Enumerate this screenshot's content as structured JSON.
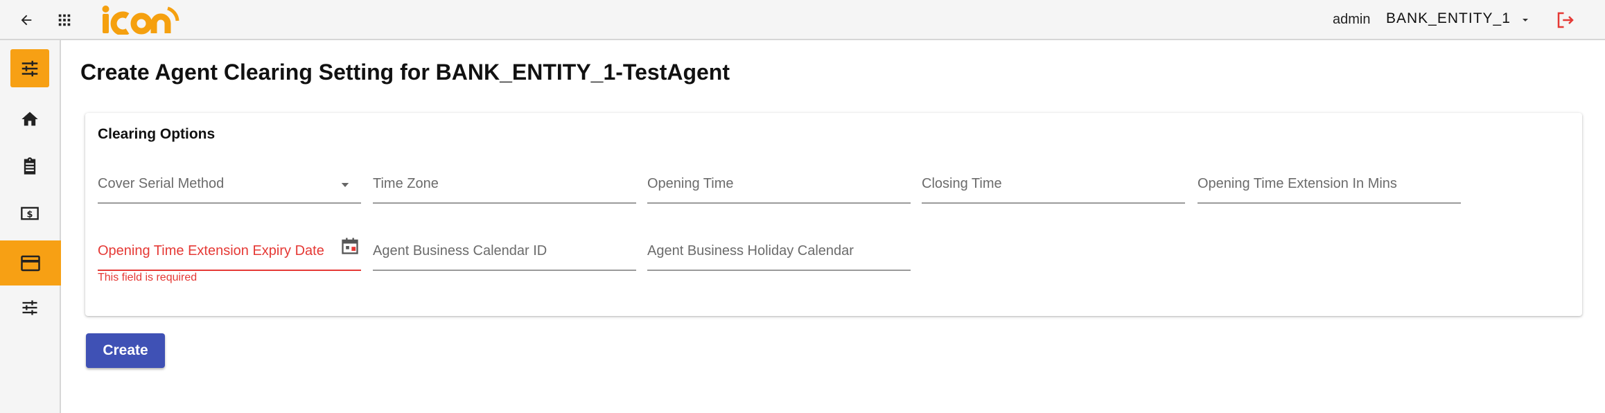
{
  "header": {
    "logo_text": "icon",
    "username": "admin",
    "entity": "BANK_ENTITY_1",
    "colors": {
      "brand": "#f5a00f",
      "logout": "#e53935"
    }
  },
  "sidebar": {
    "items": [
      {
        "name": "settings-sliders",
        "active": true
      },
      {
        "name": "home",
        "active": false
      },
      {
        "name": "clipboard",
        "active": false
      },
      {
        "name": "money",
        "active": false
      },
      {
        "name": "card",
        "active": true
      },
      {
        "name": "tune",
        "active": false
      }
    ],
    "active_color": "#f7a014"
  },
  "page": {
    "title": "Create Agent Clearing Setting for BANK_ENTITY_1-TestAgent"
  },
  "form": {
    "section_title": "Clearing Options",
    "fields": {
      "cover_serial_method": "Cover Serial Method",
      "time_zone": "Time Zone",
      "opening_time": "Opening Time",
      "closing_time": "Closing Time",
      "opening_time_extension_mins": "Opening Time Extension In Mins",
      "opening_time_extension_expiry_date": "Opening Time Extension Expiry Date",
      "agent_business_calendar_id": "Agent Business Calendar ID",
      "agent_business_holiday_calendar": "Agent Business Holiday Calendar"
    },
    "error_message": "This field is required",
    "create_label": "Create",
    "colors": {
      "error": "#e53935",
      "primary": "#3f51b5"
    }
  }
}
